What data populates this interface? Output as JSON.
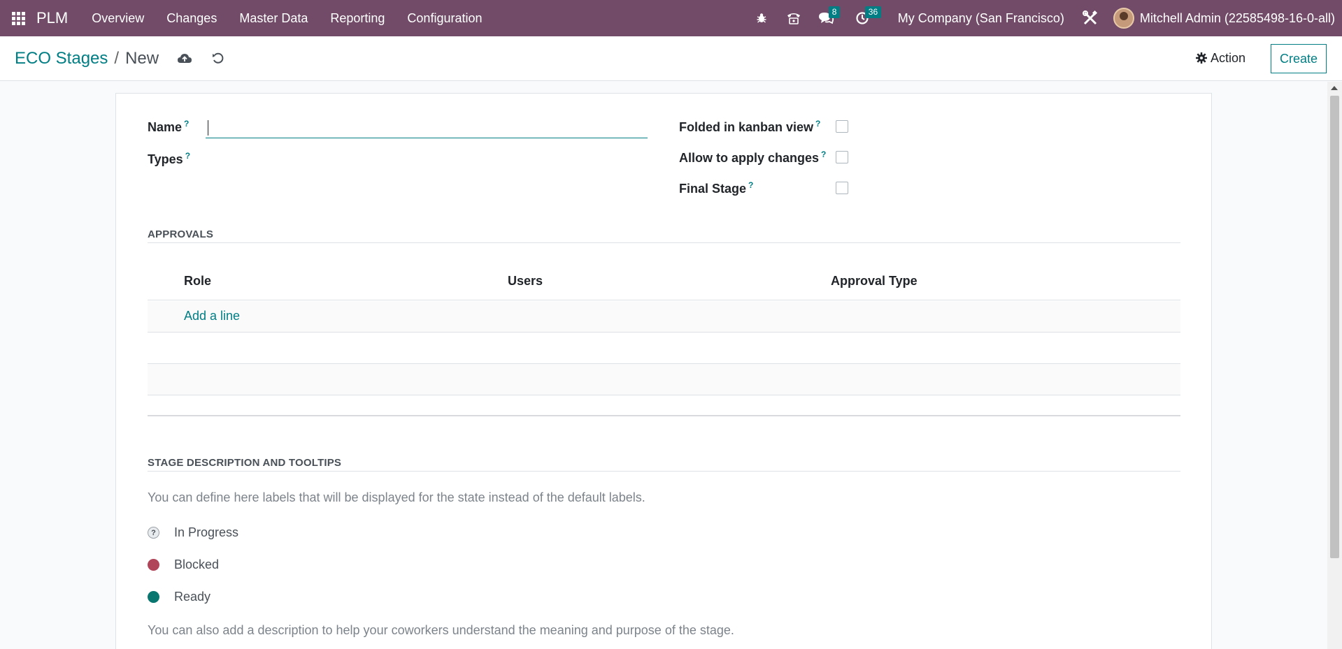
{
  "navbar": {
    "app_name": "PLM",
    "menu": [
      "Overview",
      "Changes",
      "Master Data",
      "Reporting",
      "Configuration"
    ],
    "messages_count": "8",
    "activities_count": "36",
    "company": "My Company (San Francisco)",
    "user": "Mitchell Admin (22585498-16-0-all)",
    "bg_color": "#714b67"
  },
  "breadcrumb": {
    "parent": "ECO Stages",
    "current": "New"
  },
  "control": {
    "action_label": "Action",
    "create_label": "Create"
  },
  "form": {
    "name_label": "Name",
    "name_value": "",
    "types_label": "Types",
    "folded_label": "Folded in kanban view",
    "allow_changes_label": "Allow to apply changes",
    "final_stage_label": "Final Stage",
    "tooltip_mark": "?"
  },
  "approvals": {
    "title": "APPROVALS",
    "columns": [
      "Role",
      "Users",
      "Approval Type"
    ],
    "add_line": "Add a line"
  },
  "stage_description": {
    "title": "STAGE DESCRIPTION AND TOOLTIPS",
    "intro": "You can define here labels that will be displayed for the state instead of the default labels.",
    "states": [
      {
        "label": "In Progress",
        "color": "#e9ecef"
      },
      {
        "label": "Blocked",
        "color": "#b04458"
      },
      {
        "label": "Ready",
        "color": "#0a7670"
      }
    ],
    "outro": "You can also add a description to help your coworkers understand the meaning and purpose of the stage."
  },
  "accent_color": "#017e84"
}
